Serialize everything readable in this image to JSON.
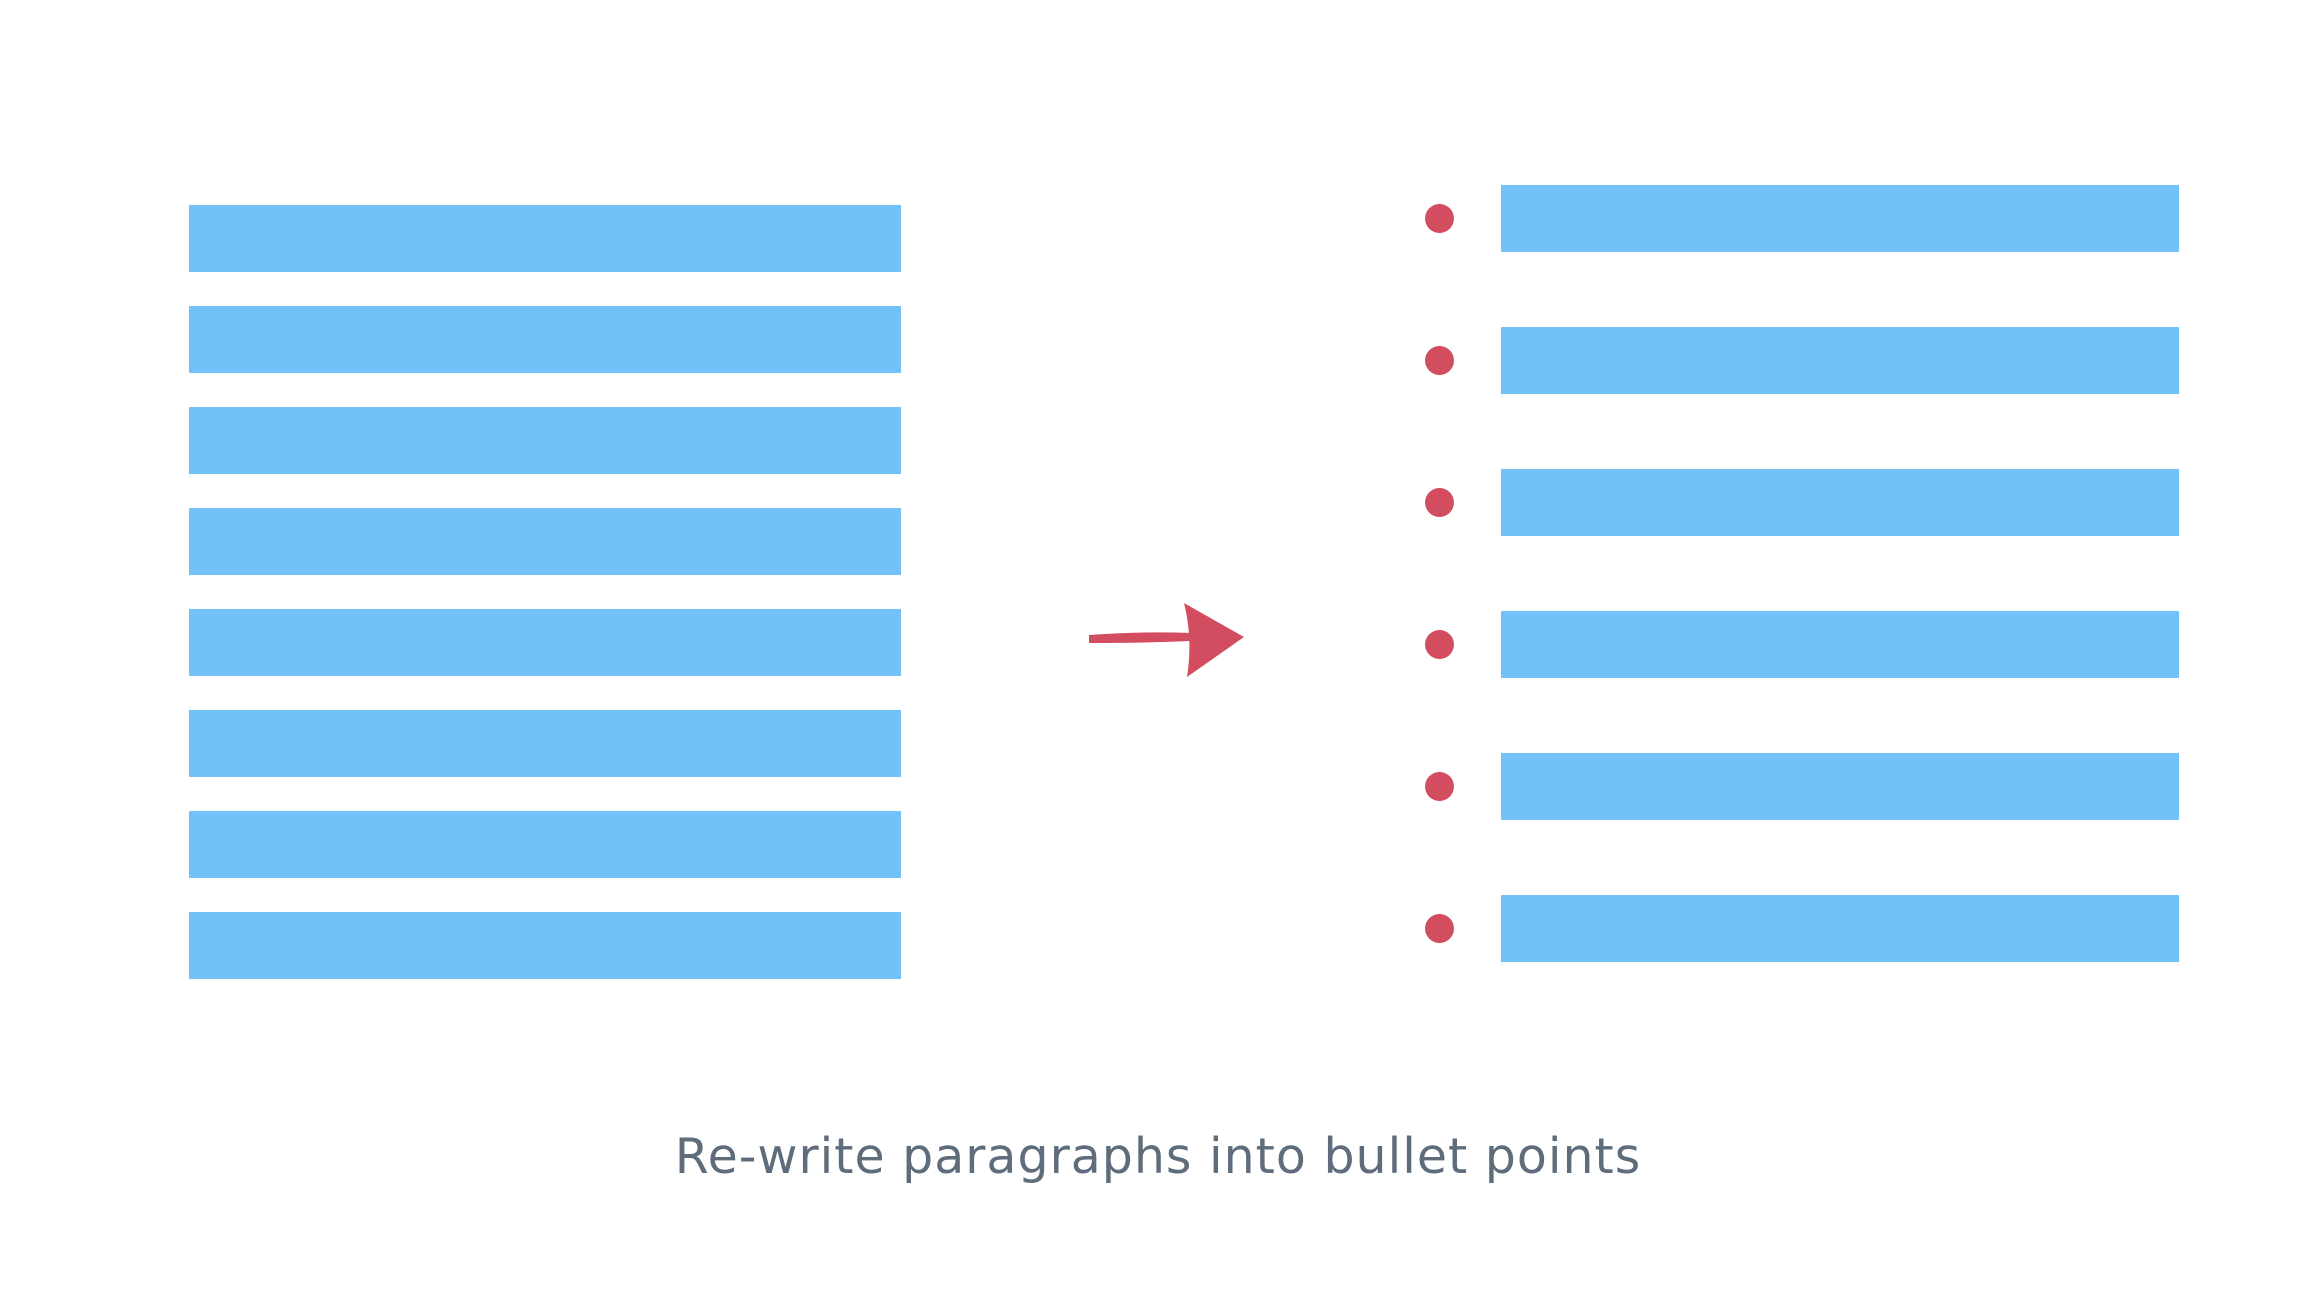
{
  "colors": {
    "background": "#ffffff",
    "text_line": "#72c1f8",
    "accent": "#d24d60",
    "caption": "#5e6c7c"
  },
  "paragraph": {
    "line_count": 8
  },
  "arrow": {
    "icon": "right-arrow-icon"
  },
  "bullets": {
    "item_count": 6,
    "icon": "bullet-dot"
  },
  "caption": "Re-write paragraphs into bullet points"
}
